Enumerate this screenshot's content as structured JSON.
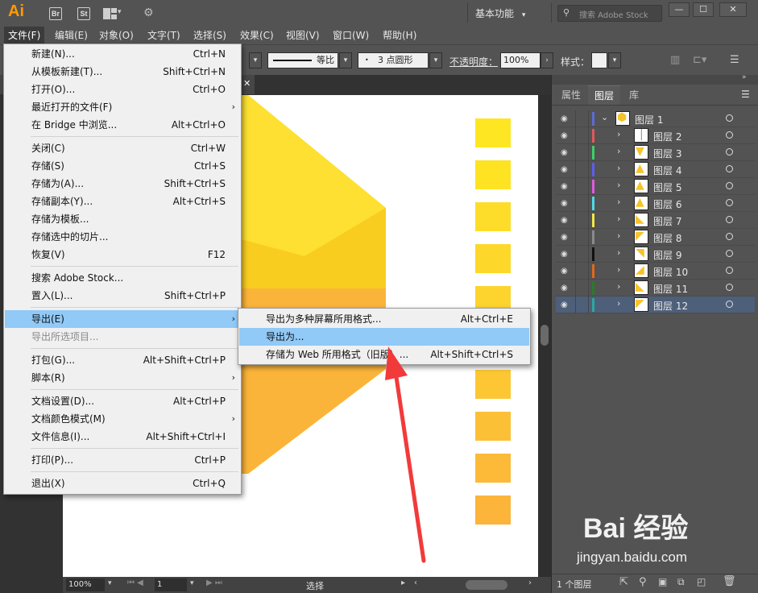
{
  "app": {
    "logo": "Ai",
    "bridge_label": "Br",
    "stock_label": "St",
    "workspace": "基本功能",
    "search_placeholder": "搜索 Adobe Stock",
    "minimize": "—",
    "maximize": "☐",
    "close": "✕"
  },
  "menubar": [
    "文件(F)",
    "编辑(E)",
    "对象(O)",
    "文字(T)",
    "选择(S)",
    "效果(C)",
    "视图(V)",
    "窗口(W)",
    "帮助(H)"
  ],
  "control": {
    "stroke_profile": "等比",
    "brush": "3 点圆形",
    "opacity_label": "不透明度：",
    "opacity_value": "100%",
    "style_label": "样式："
  },
  "file_menu": [
    {
      "label": "新建(N)...",
      "shortcut": "Ctrl+N"
    },
    {
      "label": "从模板新建(T)...",
      "shortcut": "Shift+Ctrl+N"
    },
    {
      "label": "打开(O)...",
      "shortcut": "Ctrl+O"
    },
    {
      "label": "最近打开的文件(F)",
      "shortcut": "",
      "submenu": true
    },
    {
      "label": "在 Bridge 中浏览...",
      "shortcut": "Alt+Ctrl+O"
    },
    {
      "label": "关闭(C)",
      "shortcut": "Ctrl+W"
    },
    {
      "label": "存储(S)",
      "shortcut": "Ctrl+S"
    },
    {
      "label": "存储为(A)...",
      "shortcut": "Shift+Ctrl+S"
    },
    {
      "label": "存储副本(Y)...",
      "shortcut": "Alt+Ctrl+S"
    },
    {
      "label": "存储为模板...",
      "shortcut": ""
    },
    {
      "label": "存储选中的切片...",
      "shortcut": ""
    },
    {
      "label": "恢复(V)",
      "shortcut": "F12"
    },
    {
      "label": "搜索 Adobe Stock...",
      "shortcut": ""
    },
    {
      "label": "置入(L)...",
      "shortcut": "Shift+Ctrl+P"
    },
    {
      "label": "导出(E)",
      "shortcut": "",
      "submenu": true,
      "highlighted": true
    },
    {
      "label": "导出所选项目...",
      "shortcut": "",
      "disabled": true
    },
    {
      "label": "打包(G)...",
      "shortcut": "Alt+Shift+Ctrl+P"
    },
    {
      "label": "脚本(R)",
      "shortcut": "",
      "submenu": true
    },
    {
      "label": "文档设置(D)...",
      "shortcut": "Alt+Ctrl+P"
    },
    {
      "label": "文档颜色模式(M)",
      "shortcut": "",
      "submenu": true
    },
    {
      "label": "文件信息(I)...",
      "shortcut": "Alt+Shift+Ctrl+I"
    },
    {
      "label": "打印(P)...",
      "shortcut": "Ctrl+P"
    },
    {
      "label": "退出(X)",
      "shortcut": "Ctrl+Q"
    }
  ],
  "export_submenu": [
    {
      "label": "导出为多种屏幕所用格式...",
      "shortcut": "Alt+Ctrl+E"
    },
    {
      "label": "导出为...",
      "shortcut": "",
      "highlighted": true
    },
    {
      "label": "存储为 Web 所用格式（旧版）...",
      "shortcut": "Alt+Shift+Ctrl+S"
    }
  ],
  "panel": {
    "tabs": [
      "属性",
      "图层",
      "库"
    ],
    "active_tab": "图层",
    "layers": [
      {
        "name": "图层 1",
        "color": "#5b6cd6",
        "expanded": true
      },
      {
        "name": "图层 2",
        "color": "#e05a5a"
      },
      {
        "name": "图层 3",
        "color": "#3fcf6a"
      },
      {
        "name": "图层 4",
        "color": "#5d5df0"
      },
      {
        "name": "图层 5",
        "color": "#e05be0"
      },
      {
        "name": "图层 6",
        "color": "#4fd9e6"
      },
      {
        "name": "图层 7",
        "color": "#f0e84a"
      },
      {
        "name": "图层 8",
        "color": "#8a8a8a"
      },
      {
        "name": "图层 9",
        "color": "#111111"
      },
      {
        "name": "图层 10",
        "color": "#e06a1a"
      },
      {
        "name": "图层 11",
        "color": "#2c7a2c"
      },
      {
        "name": "图层 12",
        "color": "#2aa8a0",
        "selected": true
      }
    ],
    "footer_count": "1 个图层"
  },
  "status": {
    "zoom": "100%",
    "page": "1",
    "tool": "选择"
  },
  "watermark": {
    "brand": "Bai  经验",
    "url": "jingyan.baidu.com"
  }
}
